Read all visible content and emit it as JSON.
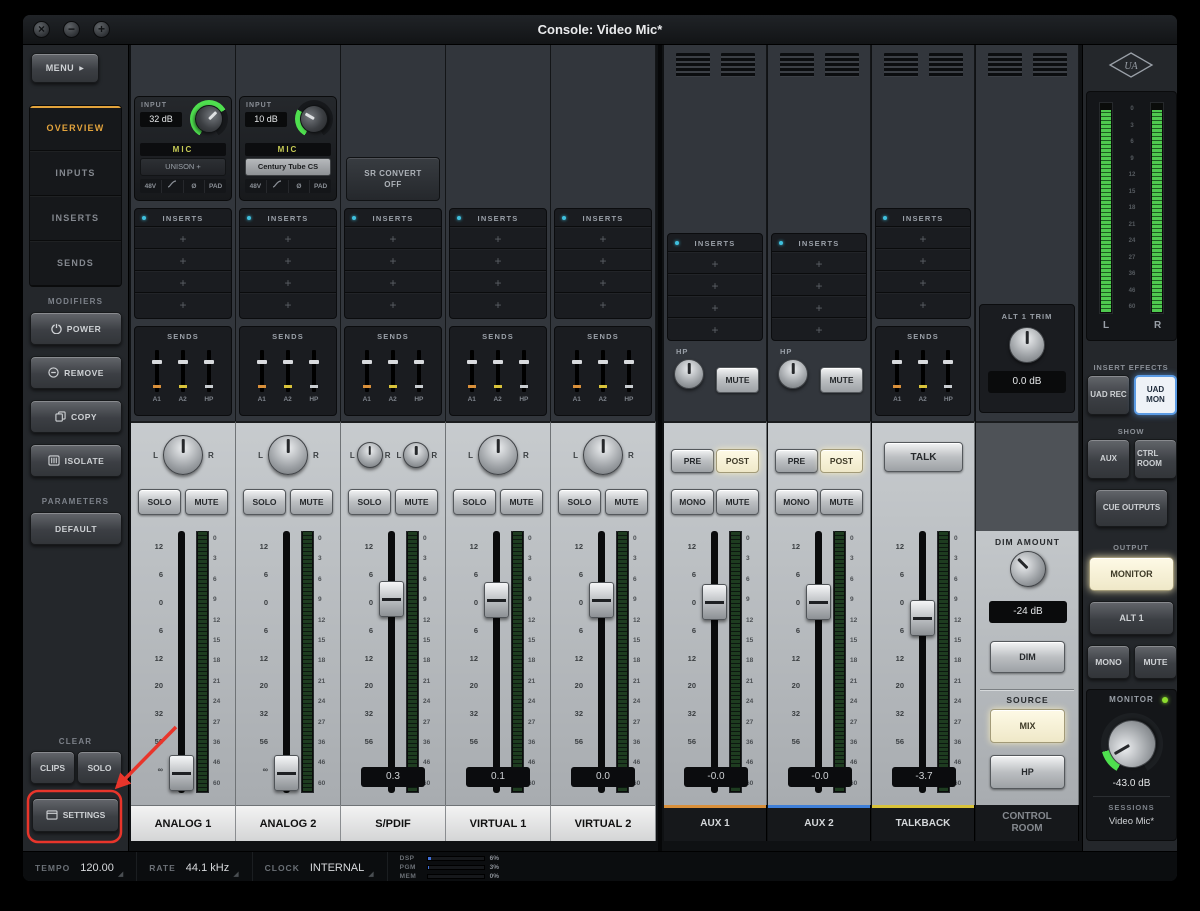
{
  "window": {
    "title": "Console: Video Mic*",
    "close_symbol": "×",
    "minimize_symbol": "−",
    "zoom_symbol": "+"
  },
  "colors": {
    "annotation_red": "#e8352b",
    "nav_active_orange": "#e2a33c",
    "aux1_accent": "#d88f3a",
    "aux2_accent": "#3f7fd8",
    "talkback_accent": "#d8c23a",
    "meter_green": "#4fc94f",
    "highlight_cream": "#f7f1d8",
    "uad_mon_blue": "#5b9be4"
  },
  "sidebar": {
    "menu": "MENU",
    "nav": [
      {
        "label": "OVERVIEW"
      },
      {
        "label": "INPUTS"
      },
      {
        "label": "INSERTS"
      },
      {
        "label": "SENDS"
      }
    ],
    "modifiers_title": "MODIFIERS",
    "power": "POWER",
    "remove": "REMOVE",
    "copy": "COPY",
    "isolate": "ISOLATE",
    "parameters_title": "PARAMETERS",
    "default": "DEFAULT",
    "clear_title": "CLEAR",
    "clips": "CLIPS",
    "solo": "SOLO",
    "settings": "SETTINGS"
  },
  "strip_common": {
    "inserts_title": "INSERTS",
    "sends_title": "SENDS",
    "send_labels": [
      "A1",
      "A2",
      "HP"
    ],
    "plus": "+",
    "solo": "SOLO",
    "mute": "MUTE",
    "pan_l": "L",
    "pan_r": "R",
    "fader_scale": [
      "12",
      "6",
      "0",
      "6",
      "12",
      "20",
      "32",
      "56",
      "∞"
    ],
    "meter_scale": [
      "0",
      "3",
      "6",
      "9",
      "12",
      "15",
      "18",
      "21",
      "24",
      "27",
      "36",
      "46",
      "60"
    ]
  },
  "channels": [
    {
      "label": "ANALOG 1",
      "input_title": "INPUT",
      "gain": "32 dB",
      "source": "MIC",
      "slot": "UNISON +",
      "phantom": "48V",
      "phase": "Ø",
      "pad": "PAD",
      "value": ""
    },
    {
      "label": "ANALOG 2",
      "input_title": "INPUT",
      "gain": "10 dB",
      "source": "MIC",
      "slot": "Century Tube CS",
      "phantom": "48V",
      "phase": "Ø",
      "pad": "PAD",
      "value": ""
    },
    {
      "label": "S/PDIF",
      "sr_convert_label": "SR CONVERT",
      "sr_convert_value": "OFF",
      "value": "0.3"
    },
    {
      "label": "VIRTUAL 1",
      "value": "0.1"
    },
    {
      "label": "VIRTUAL 2",
      "value": "0.0"
    }
  ],
  "aux": {
    "pre": "PRE",
    "post": "POST",
    "mono": "MONO",
    "mute": "MUTE",
    "hp": "HP",
    "strips": [
      {
        "label": "AUX 1",
        "value": "-0.0",
        "accent": "#d88f3a"
      },
      {
        "label": "AUX 2",
        "value": "-0.0",
        "accent": "#3f7fd8"
      }
    ]
  },
  "talkback": {
    "label": "TALKBACK",
    "talk": "TALK",
    "value": "-3.7",
    "accent": "#d8c23a"
  },
  "control_room": {
    "label_line1": "CONTROL",
    "label_line2": "ROOM",
    "alt1_trim_title": "ALT 1 TRIM",
    "alt1_trim_value": "0.0 dB",
    "dim_title": "DIM AMOUNT",
    "dim_value": "-24 dB",
    "dim_button": "DIM",
    "source_title": "SOURCE",
    "mix": "MIX",
    "hp": "HP"
  },
  "master": {
    "meter_l": "L",
    "meter_r": "R",
    "insert_effects_title": "INSERT EFFECTS",
    "uad_rec": "UAD REC",
    "uad_mon": "UAD MON",
    "show_title": "SHOW",
    "aux_btn": "AUX",
    "ctrl_room_btn": "CTRL ROOM",
    "cue_outputs": "CUE OUTPUTS",
    "output_title": "OUTPUT",
    "monitor_btn": "MONITOR",
    "alt1_btn": "ALT 1",
    "mono": "MONO",
    "mute": "MUTE",
    "monitor_panel_title": "MONITOR",
    "monitor_level": "-43.0 dB",
    "sessions_title": "SESSIONS",
    "session_name": "Video Mic*"
  },
  "status_bar": {
    "tempo_label": "TEMPO",
    "tempo_value": "120.00",
    "rate_label": "RATE",
    "rate_value": "44.1 kHz",
    "clock_label": "CLOCK",
    "clock_value": "INTERNAL",
    "dsp_label": "DSP",
    "dsp_pct": "6%",
    "pgm_label": "PGM",
    "pgm_pct": "3%",
    "mem_label": "MEM",
    "mem_pct": "0%"
  }
}
